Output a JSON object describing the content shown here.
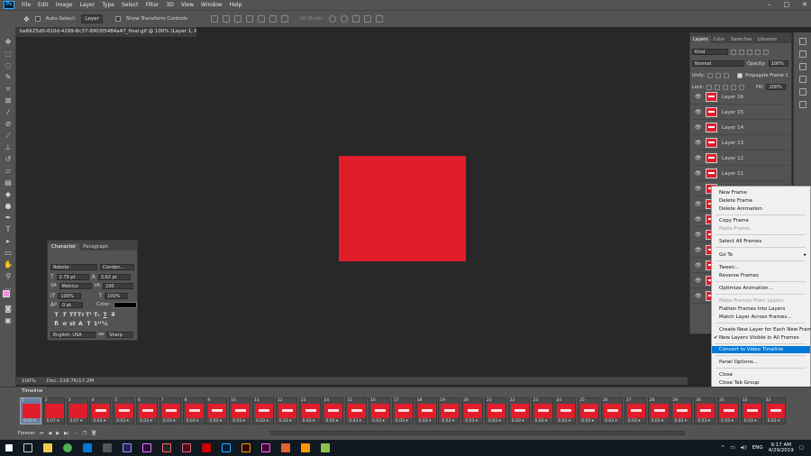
{
  "menu": {
    "app_icon": "photoshop-logo",
    "items": [
      "File",
      "Edit",
      "Image",
      "Layer",
      "Type",
      "Select",
      "Filter",
      "3D",
      "View",
      "Window",
      "Help"
    ],
    "window_controls": [
      "–",
      "□",
      "✕"
    ]
  },
  "options": {
    "auto_select_label": "Auto-Select:",
    "auto_select_target": "Layer",
    "show_transform_label": "Show Transform Controls",
    "threed_mode_label": "3D Mode:"
  },
  "document": {
    "tab_title": "be6625d0-810d-4299-8c37-9903f5484a47_final.gif @ 100% (Layer 1, RGB/8) *",
    "canvas_color": "#e11d2c"
  },
  "status": {
    "zoom": "100%",
    "doc_info": "Doc: 219.7K/17.2M"
  },
  "character_panel": {
    "tabs": [
      "Character",
      "Paragraph"
    ],
    "font_family": "Roboto",
    "font_style": "Conden...",
    "font_size": "2.79 pt",
    "leading": "3.62 pt",
    "kerning": "Metrics",
    "tracking": "100",
    "vertical_scale": "100%",
    "horizontal_scale": "100%",
    "baseline_shift": "0 pt",
    "color_label": "Color:",
    "language": "English: USA",
    "antialias": "Sharp"
  },
  "layers_panel": {
    "tabs": [
      "Layers",
      "Color",
      "Swatches",
      "Libraries"
    ],
    "filter_kind": "Kind",
    "blend_mode": "Normal",
    "opacity_label": "Opacity:",
    "opacity": "100%",
    "unify_label": "Unify:",
    "propagate_label": "Propagate Frame 1",
    "lock_label": "Lock:",
    "fill_label": "Fill:",
    "fill": "100%",
    "layers": [
      "Layer 16",
      "Layer 15",
      "Layer 14",
      "Layer 13",
      "Layer 12",
      "Layer 11",
      "",
      "",
      "",
      "",
      "",
      "",
      "",
      ""
    ]
  },
  "context_menu": {
    "items": [
      {
        "label": "New Frame",
        "state": "normal"
      },
      {
        "label": "Delete Frame",
        "state": "normal"
      },
      {
        "label": "Delete Animation",
        "state": "normal"
      },
      {
        "label": "Copy Frame",
        "state": "normal"
      },
      {
        "label": "Paste Frame...",
        "state": "disabled"
      },
      {
        "label": "Select All Frames",
        "state": "normal"
      },
      {
        "label": "Go To",
        "state": "submenu"
      },
      {
        "label": "Tween...",
        "state": "normal"
      },
      {
        "label": "Reverse Frames",
        "state": "normal"
      },
      {
        "label": "Optimize Animation...",
        "state": "normal"
      },
      {
        "label": "Make Frames From Layers",
        "state": "disabled"
      },
      {
        "label": "Flatten Frames Into Layers",
        "state": "normal"
      },
      {
        "label": "Match Layer Across Frames...",
        "state": "normal"
      },
      {
        "label": "Create New Layer for Each New Frame",
        "state": "normal"
      },
      {
        "label": "New Layers Visible in All Frames",
        "state": "checked"
      },
      {
        "label": "Convert to Video Timeline",
        "state": "highlighted"
      },
      {
        "label": "Panel Options...",
        "state": "normal"
      },
      {
        "label": "Close",
        "state": "normal"
      },
      {
        "label": "Close Tab Group",
        "state": "normal"
      }
    ]
  },
  "timeline": {
    "tab": "Timeline",
    "loop": "Forever",
    "frames": [
      {
        "n": "1",
        "delay": "0.03 ▾"
      },
      {
        "n": "2",
        "delay": "0.07 ▾"
      },
      {
        "n": "3",
        "delay": "0.07 ▾"
      },
      {
        "n": "4",
        "delay": "0.03 ▾"
      },
      {
        "n": "5",
        "delay": "0.03 ▾"
      },
      {
        "n": "6",
        "delay": "0.03 ▾"
      },
      {
        "n": "7",
        "delay": "0.03 ▾"
      },
      {
        "n": "8",
        "delay": "0.03 ▾"
      },
      {
        "n": "9",
        "delay": "0.03 ▾"
      },
      {
        "n": "10",
        "delay": "0.03 ▾"
      },
      {
        "n": "11",
        "delay": "0.03 ▾"
      },
      {
        "n": "12",
        "delay": "0.03 ▾"
      },
      {
        "n": "13",
        "delay": "0.03 ▾"
      },
      {
        "n": "14",
        "delay": "0.03 ▾"
      },
      {
        "n": "15",
        "delay": "0.03 ▾"
      },
      {
        "n": "16",
        "delay": "0.03 ▾"
      },
      {
        "n": "17",
        "delay": "0.03 ▾"
      },
      {
        "n": "18",
        "delay": "0.03 ▾"
      },
      {
        "n": "19",
        "delay": "0.03 ▾"
      },
      {
        "n": "20",
        "delay": "0.03 ▾"
      },
      {
        "n": "21",
        "delay": "0.03 ▾"
      },
      {
        "n": "22",
        "delay": "0.03 ▾"
      },
      {
        "n": "23",
        "delay": "0.03 ▾"
      },
      {
        "n": "24",
        "delay": "0.03 ▾"
      },
      {
        "n": "25",
        "delay": "0.03 ▾"
      },
      {
        "n": "26",
        "delay": "0.03 ▾"
      },
      {
        "n": "27",
        "delay": "0.03 ▾"
      },
      {
        "n": "28",
        "delay": "0.03 ▾"
      },
      {
        "n": "29",
        "delay": "0.03 ▾"
      },
      {
        "n": "30",
        "delay": "0.03 ▾"
      },
      {
        "n": "31",
        "delay": "0.03 ▾"
      },
      {
        "n": "32",
        "delay": "0.03 ▾"
      },
      {
        "n": "33",
        "delay": "0.03 ▾"
      }
    ]
  },
  "taskbar": {
    "lang": "ENG",
    "time": "9:17 AM",
    "date": "4/29/2019"
  }
}
